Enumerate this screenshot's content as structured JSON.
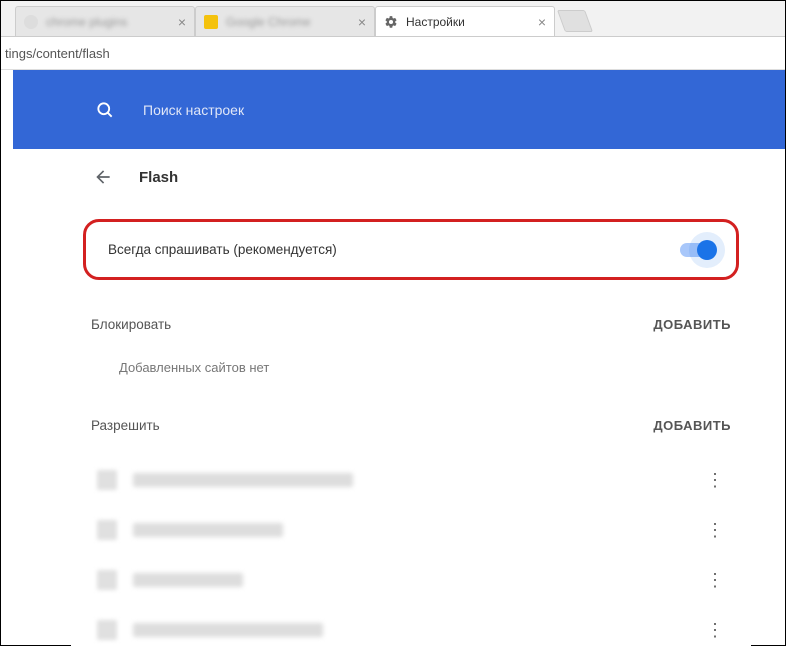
{
  "tabs": {
    "inactive1": "chrome plugins",
    "inactive2": "Google Chrome",
    "active": "Настройки"
  },
  "address_bar": "tings/content/flash",
  "search": {
    "placeholder": "Поиск настроек"
  },
  "page": {
    "title": "Flash"
  },
  "toggle": {
    "label": "Всегда спрашивать (рекомендуется)",
    "on": true
  },
  "block": {
    "title": "Блокировать",
    "add": "ДОБАВИТЬ",
    "empty": "Добавленных сайтов нет"
  },
  "allow": {
    "title": "Разрешить",
    "add": "ДОБАВИТЬ"
  }
}
